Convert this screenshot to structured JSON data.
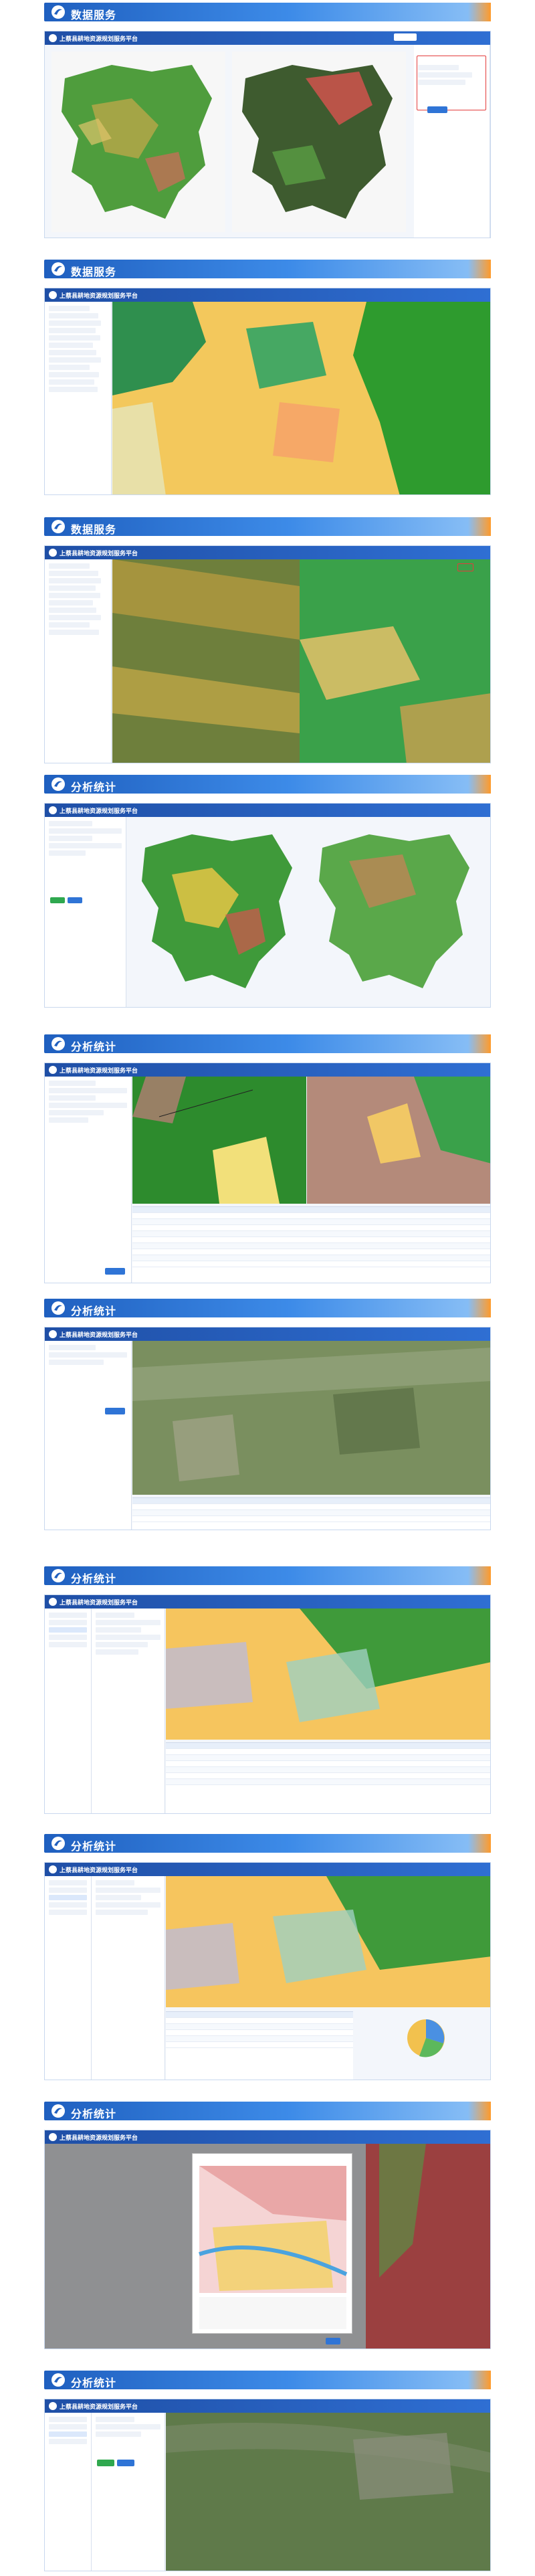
{
  "sections": [
    {
      "title": "数据服务"
    },
    {
      "title": "数据服务"
    },
    {
      "title": "数据服务"
    },
    {
      "title": "分析统计"
    },
    {
      "title": "分析统计"
    },
    {
      "title": "分析统计"
    },
    {
      "title": "分析统计"
    },
    {
      "title": "分析统计"
    },
    {
      "title": "分析统计"
    },
    {
      "title": "分析统计"
    }
  ],
  "app": {
    "title": "上蔡县耕地资源规划服务平台"
  },
  "colors": {
    "banner_start": "#1f5fbf",
    "banner_end": "#8fc3f7",
    "accent_orange": "#ff9a2a",
    "app_bar": "#1f4fa6",
    "highlight_red": "#e33b3b",
    "land_green": "#3f9a3a",
    "land_yellow": "#f2cf63",
    "land_red": "#d9534f"
  },
  "icons": [
    "banner-logo-icon",
    "app-logo-icon"
  ]
}
